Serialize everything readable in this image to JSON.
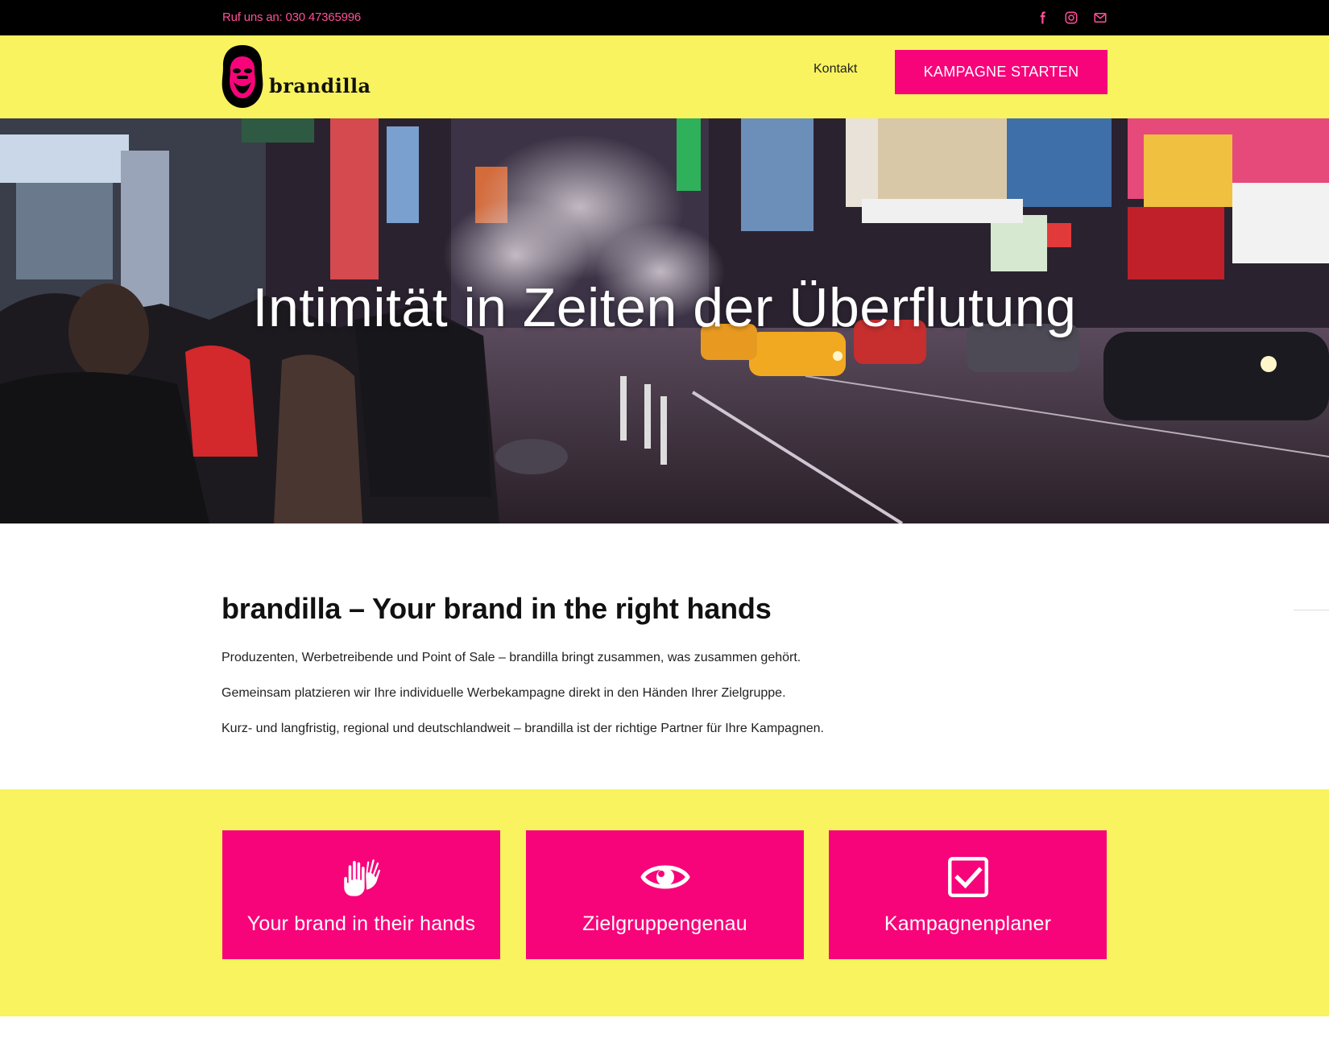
{
  "topbar": {
    "phone": "Ruf uns an: 030 47365996",
    "social": [
      {
        "icon": "facebook-icon"
      },
      {
        "icon": "instagram-icon"
      },
      {
        "icon": "mail-icon"
      }
    ]
  },
  "header": {
    "logo_text": "brandilla",
    "nav_contact": "Kontakt",
    "cta_label": "KAMPAGNE STARTEN"
  },
  "hero": {
    "title": "Intimität in Zeiten der Überflutung"
  },
  "intro": {
    "heading": "brandilla – Your brand in the right hands",
    "paragraphs": [
      "Produzenten, Werbetreibende und Point of Sale – brandilla bringt zusammen, was zusammen gehört.",
      "Gemeinsam platzieren wir Ihre individuelle Werbekampagne direkt in den Händen Ihrer Zielgruppe.",
      "Kurz- und langfristig, regional und deutschlandweit – brandilla ist der richtige Partner für Ihre Kampagnen."
    ]
  },
  "features": [
    {
      "icon": "hands-icon",
      "label": "Your brand in their hands"
    },
    {
      "icon": "eye-icon",
      "label": "Zielgruppengenau"
    },
    {
      "icon": "checkbox-icon",
      "label": "Kampagnenplaner"
    }
  ],
  "colors": {
    "accent_pink": "#f7047a",
    "yellow": "#f8f35e",
    "topbar_black": "#000000"
  }
}
